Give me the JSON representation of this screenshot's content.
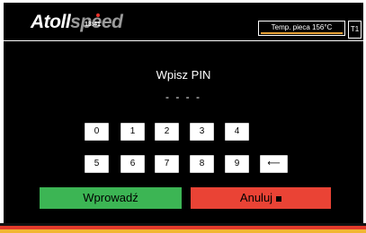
{
  "header": {
    "logo_primary": "Atoll",
    "logo_secondary": "speed",
    "time": "13:41",
    "temperature_label": "Temp. pieca 156°C",
    "t1_label": "T1"
  },
  "pin_dialog": {
    "title": "Wpisz PIN",
    "pin_mask": "- - - -",
    "keys_row1": [
      "0",
      "1",
      "2",
      "3",
      "4"
    ],
    "keys_row2": [
      "5",
      "6",
      "7",
      "8",
      "9",
      "⟵"
    ],
    "enter_label": "Wprowadź",
    "cancel_label": "Anuluj"
  },
  "colors": {
    "enter_button": "#3cb554",
    "cancel_button": "#ea4335",
    "alert_dot": "#e8322a",
    "temp_bar": "#e8a33a",
    "stripe_black": "#111111",
    "stripe_red": "#e23a2b",
    "stripe_gold": "#f2b632"
  }
}
